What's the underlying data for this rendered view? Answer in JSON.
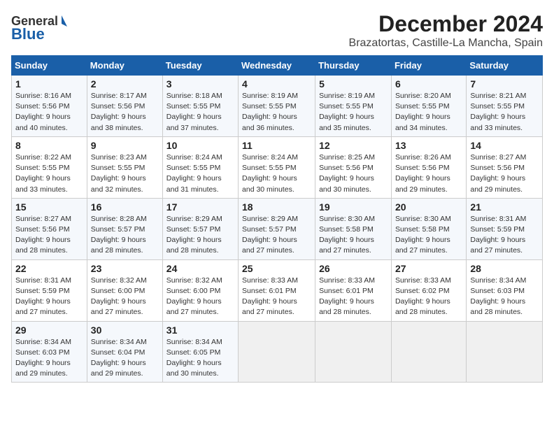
{
  "header": {
    "logo_general": "General",
    "logo_blue": "Blue",
    "title": "December 2024",
    "location": "Brazatortas, Castille-La Mancha, Spain"
  },
  "days_of_week": [
    "Sunday",
    "Monday",
    "Tuesday",
    "Wednesday",
    "Thursday",
    "Friday",
    "Saturday"
  ],
  "weeks": [
    [
      {
        "day": "1",
        "sunrise": "8:16 AM",
        "sunset": "5:56 PM",
        "daylight": "9 hours and 40 minutes."
      },
      {
        "day": "2",
        "sunrise": "8:17 AM",
        "sunset": "5:56 PM",
        "daylight": "9 hours and 38 minutes."
      },
      {
        "day": "3",
        "sunrise": "8:18 AM",
        "sunset": "5:55 PM",
        "daylight": "9 hours and 37 minutes."
      },
      {
        "day": "4",
        "sunrise": "8:19 AM",
        "sunset": "5:55 PM",
        "daylight": "9 hours and 36 minutes."
      },
      {
        "day": "5",
        "sunrise": "8:19 AM",
        "sunset": "5:55 PM",
        "daylight": "9 hours and 35 minutes."
      },
      {
        "day": "6",
        "sunrise": "8:20 AM",
        "sunset": "5:55 PM",
        "daylight": "9 hours and 34 minutes."
      },
      {
        "day": "7",
        "sunrise": "8:21 AM",
        "sunset": "5:55 PM",
        "daylight": "9 hours and 33 minutes."
      }
    ],
    [
      {
        "day": "8",
        "sunrise": "8:22 AM",
        "sunset": "5:55 PM",
        "daylight": "9 hours and 33 minutes."
      },
      {
        "day": "9",
        "sunrise": "8:23 AM",
        "sunset": "5:55 PM",
        "daylight": "9 hours and 32 minutes."
      },
      {
        "day": "10",
        "sunrise": "8:24 AM",
        "sunset": "5:55 PM",
        "daylight": "9 hours and 31 minutes."
      },
      {
        "day": "11",
        "sunrise": "8:24 AM",
        "sunset": "5:55 PM",
        "daylight": "9 hours and 30 minutes."
      },
      {
        "day": "12",
        "sunrise": "8:25 AM",
        "sunset": "5:56 PM",
        "daylight": "9 hours and 30 minutes."
      },
      {
        "day": "13",
        "sunrise": "8:26 AM",
        "sunset": "5:56 PM",
        "daylight": "9 hours and 29 minutes."
      },
      {
        "day": "14",
        "sunrise": "8:27 AM",
        "sunset": "5:56 PM",
        "daylight": "9 hours and 29 minutes."
      }
    ],
    [
      {
        "day": "15",
        "sunrise": "8:27 AM",
        "sunset": "5:56 PM",
        "daylight": "9 hours and 28 minutes."
      },
      {
        "day": "16",
        "sunrise": "8:28 AM",
        "sunset": "5:57 PM",
        "daylight": "9 hours and 28 minutes."
      },
      {
        "day": "17",
        "sunrise": "8:29 AM",
        "sunset": "5:57 PM",
        "daylight": "9 hours and 28 minutes."
      },
      {
        "day": "18",
        "sunrise": "8:29 AM",
        "sunset": "5:57 PM",
        "daylight": "9 hours and 27 minutes."
      },
      {
        "day": "19",
        "sunrise": "8:30 AM",
        "sunset": "5:58 PM",
        "daylight": "9 hours and 27 minutes."
      },
      {
        "day": "20",
        "sunrise": "8:30 AM",
        "sunset": "5:58 PM",
        "daylight": "9 hours and 27 minutes."
      },
      {
        "day": "21",
        "sunrise": "8:31 AM",
        "sunset": "5:59 PM",
        "daylight": "9 hours and 27 minutes."
      }
    ],
    [
      {
        "day": "22",
        "sunrise": "8:31 AM",
        "sunset": "5:59 PM",
        "daylight": "9 hours and 27 minutes."
      },
      {
        "day": "23",
        "sunrise": "8:32 AM",
        "sunset": "6:00 PM",
        "daylight": "9 hours and 27 minutes."
      },
      {
        "day": "24",
        "sunrise": "8:32 AM",
        "sunset": "6:00 PM",
        "daylight": "9 hours and 27 minutes."
      },
      {
        "day": "25",
        "sunrise": "8:33 AM",
        "sunset": "6:01 PM",
        "daylight": "9 hours and 27 minutes."
      },
      {
        "day": "26",
        "sunrise": "8:33 AM",
        "sunset": "6:01 PM",
        "daylight": "9 hours and 28 minutes."
      },
      {
        "day": "27",
        "sunrise": "8:33 AM",
        "sunset": "6:02 PM",
        "daylight": "9 hours and 28 minutes."
      },
      {
        "day": "28",
        "sunrise": "8:34 AM",
        "sunset": "6:03 PM",
        "daylight": "9 hours and 28 minutes."
      }
    ],
    [
      {
        "day": "29",
        "sunrise": "8:34 AM",
        "sunset": "6:03 PM",
        "daylight": "9 hours and 29 minutes."
      },
      {
        "day": "30",
        "sunrise": "8:34 AM",
        "sunset": "6:04 PM",
        "daylight": "9 hours and 29 minutes."
      },
      {
        "day": "31",
        "sunrise": "8:34 AM",
        "sunset": "6:05 PM",
        "daylight": "9 hours and 30 minutes."
      },
      null,
      null,
      null,
      null
    ]
  ],
  "labels": {
    "sunrise": "Sunrise:",
    "sunset": "Sunset:",
    "daylight": "Daylight:"
  }
}
